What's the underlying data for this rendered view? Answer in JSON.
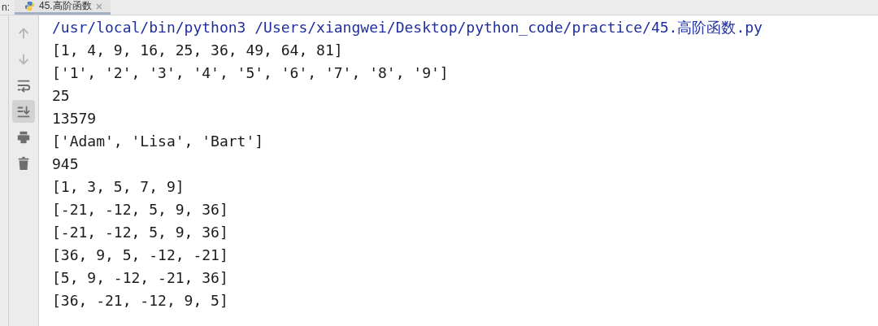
{
  "header": {
    "run_label": "n:",
    "tabs": [
      {
        "label": "45.高阶函数",
        "selected": true,
        "closable": true
      }
    ]
  },
  "toolbar": [
    {
      "kind": "up",
      "disabled": true,
      "selected": false
    },
    {
      "kind": "down",
      "disabled": true,
      "selected": false
    },
    {
      "kind": "wrap",
      "disabled": false,
      "selected": false
    },
    {
      "kind": "scroll-end",
      "disabled": false,
      "selected": true
    },
    {
      "kind": "print",
      "disabled": false,
      "selected": false
    },
    {
      "kind": "trash",
      "disabled": false,
      "selected": false
    }
  ],
  "console": [
    {
      "kind": "command",
      "text": "/usr/local/bin/python3 /Users/xiangwei/Desktop/python_code/practice/45.高阶函数.py"
    },
    {
      "kind": "output",
      "text": "[1, 4, 9, 16, 25, 36, 49, 64, 81]"
    },
    {
      "kind": "output",
      "text": "['1', '2', '3', '4', '5', '6', '7', '8', '9']"
    },
    {
      "kind": "output",
      "text": "25"
    },
    {
      "kind": "output",
      "text": "13579"
    },
    {
      "kind": "output",
      "text": "['Adam', 'Lisa', 'Bart']"
    },
    {
      "kind": "output",
      "text": "945"
    },
    {
      "kind": "output",
      "text": "[1, 3, 5, 7, 9]"
    },
    {
      "kind": "output",
      "text": "[-21, -12, 5, 9, 36]"
    },
    {
      "kind": "output",
      "text": "[-21, -12, 5, 9, 36]"
    },
    {
      "kind": "output",
      "text": "[36, 9, 5, -12, -21]"
    },
    {
      "kind": "output",
      "text": "[5, 9, -12, -21, 36]"
    },
    {
      "kind": "output",
      "text": "[36, -21, -12, 9, 5]"
    }
  ]
}
